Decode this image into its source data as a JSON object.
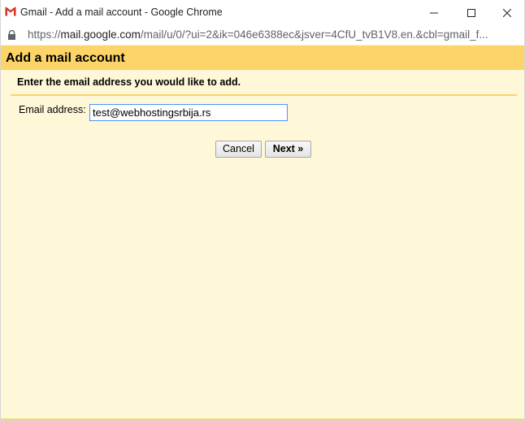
{
  "window": {
    "title": "Gmail - Add a mail account - Google Chrome",
    "icon": "gmail-icon"
  },
  "address_bar": {
    "scheme": "https://",
    "host": "mail.google.com",
    "path": "/mail/u/0/?ui=2&ik=046e6388ec&jsver=4CfU_tvB1V8.en.&cbl=gmail_f..."
  },
  "dialog": {
    "header": "Add a mail account",
    "instruction": "Enter the email address you would like to add.",
    "email_label": "Email address:",
    "email_value": "test@webhostingsrbija.rs",
    "cancel_label": "Cancel",
    "next_label": "Next »"
  },
  "colors": {
    "header_bg": "#fcd467",
    "body_bg": "#fff8d8",
    "input_focus_border": "#4d90fe"
  }
}
